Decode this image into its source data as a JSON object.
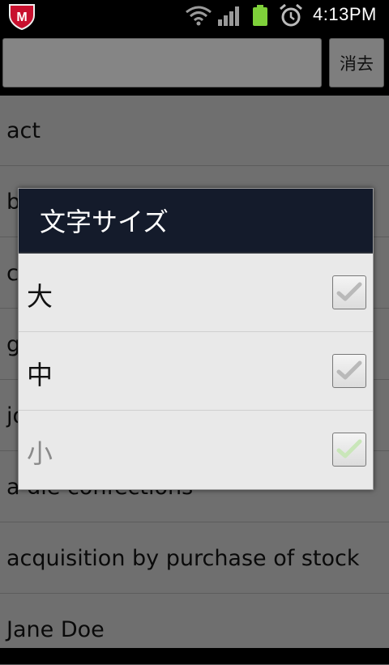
{
  "status_bar": {
    "time": "4:13PM",
    "icons": [
      "mcafee-shield-icon",
      "wifi-icon",
      "signal-icon",
      "battery-icon",
      "alarm-clock-icon"
    ],
    "battery_color": "#7fd13a"
  },
  "search": {
    "value": "",
    "clear_label": "消去"
  },
  "list": {
    "items": [
      "act",
      "b",
      "c",
      "g",
      "jo",
      "a die confections",
      "acquisition by purchase of stock",
      "Jane Doe"
    ]
  },
  "dialog": {
    "title": "文字サイズ",
    "options": [
      {
        "label": "大",
        "checked": true
      },
      {
        "label": "中",
        "checked": true
      },
      {
        "label": "小",
        "checked": true
      }
    ]
  }
}
